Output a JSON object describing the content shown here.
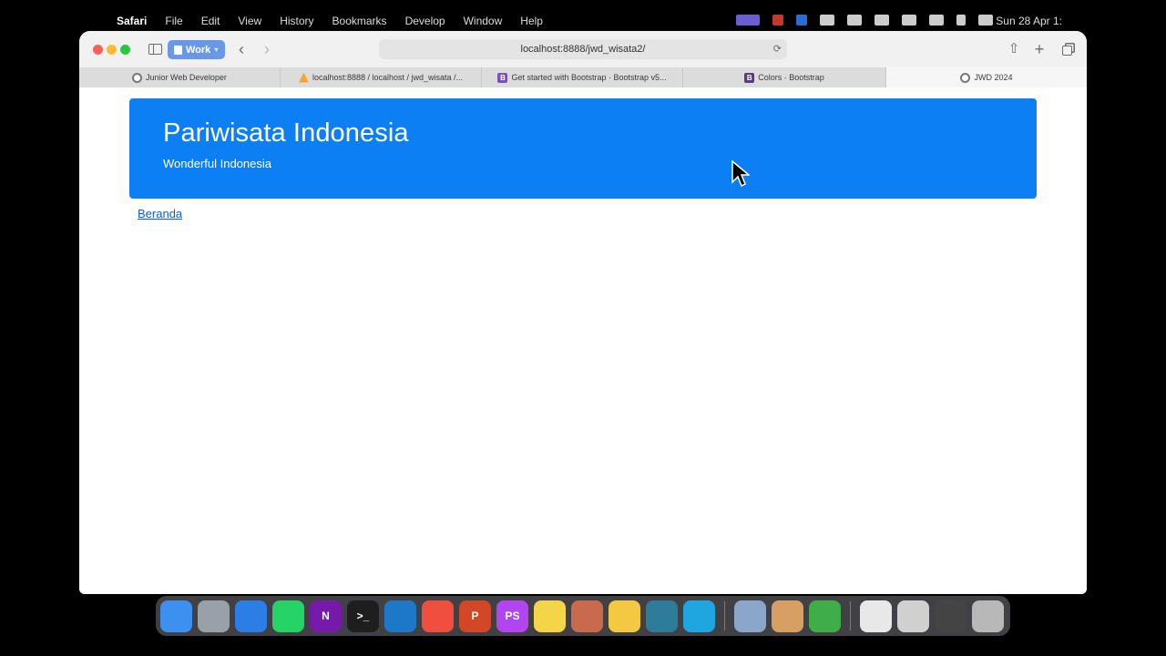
{
  "menubar": {
    "app_name": "Safari",
    "items": [
      "File",
      "Edit",
      "View",
      "History",
      "Bookmarks",
      "Develop",
      "Window",
      "Help"
    ],
    "clock": "Sun 28 Apr  1:"
  },
  "browser": {
    "profile_label": "Work",
    "address": "localhost:8888/jwd_wisata2/",
    "tabs": [
      {
        "label": "Junior Web Developer",
        "icon": "github-icon"
      },
      {
        "label": "localhost:8888 / localhost / jwd_wisata /...",
        "icon": "phpmyadmin-icon"
      },
      {
        "label": "Get started with Bootstrap · Bootstrap v5...",
        "icon": "bootstrap-icon"
      },
      {
        "label": "Colors · Bootstrap",
        "icon": "bootstrap-icon"
      },
      {
        "label": "JWD 2024",
        "icon": "github-icon",
        "active": true
      }
    ]
  },
  "page": {
    "heading": "Pariwisata Indonesia",
    "subheading": "Wonderful Indonesia",
    "nav_link": "Beranda",
    "accent": "#0d7ff4",
    "link_color": "#0b5ed7"
  },
  "dock": {
    "apps": [
      {
        "name": "finder-icon",
        "color": "#3d8ff0",
        "glyph": ""
      },
      {
        "name": "launchpad-icon",
        "color": "#9aa0a8",
        "glyph": ""
      },
      {
        "name": "safari-icon",
        "color": "#2a7ee6",
        "glyph": ""
      },
      {
        "name": "whatsapp-icon",
        "color": "#25d366",
        "glyph": ""
      },
      {
        "name": "onenote-icon",
        "color": "#7719aa",
        "glyph": "N"
      },
      {
        "name": "terminal-icon",
        "color": "#1e1e1e",
        "glyph": ">_"
      },
      {
        "name": "vscode-icon",
        "color": "#1e78c8",
        "glyph": ""
      },
      {
        "name": "pen-app-icon",
        "color": "#f04e3e",
        "glyph": ""
      },
      {
        "name": "powerpoint-icon",
        "color": "#d24726",
        "glyph": "P"
      },
      {
        "name": "phpstorm-icon",
        "color": "#b345f1",
        "glyph": "PS"
      },
      {
        "name": "notes-icon",
        "color": "#f5d548",
        "glyph": ""
      },
      {
        "name": "affinity-icon",
        "color": "#c86a4d",
        "glyph": ""
      },
      {
        "name": "shell-app-icon",
        "color": "#f5c842",
        "glyph": ""
      },
      {
        "name": "mammoth-icon",
        "color": "#2d7d9a",
        "glyph": ""
      },
      {
        "name": "edge-icon",
        "color": "#1fa5e0",
        "glyph": ""
      },
      {
        "name": "preview-icon",
        "color": "#8aa6c8",
        "glyph": ""
      },
      {
        "name": "archive-icon",
        "color": "#d8a060",
        "glyph": ""
      },
      {
        "name": "camtasia-icon",
        "color": "#3fae49",
        "glyph": ""
      },
      {
        "name": "document-icon",
        "color": "#e8e8e8",
        "glyph": ""
      },
      {
        "name": "folder-window-icon",
        "color": "#d0d0d0",
        "glyph": ""
      },
      {
        "name": "screen-recorder-icon",
        "color": "#444",
        "glyph": ""
      },
      {
        "name": "trash-icon",
        "color": "#b8b8b8",
        "glyph": ""
      }
    ]
  }
}
